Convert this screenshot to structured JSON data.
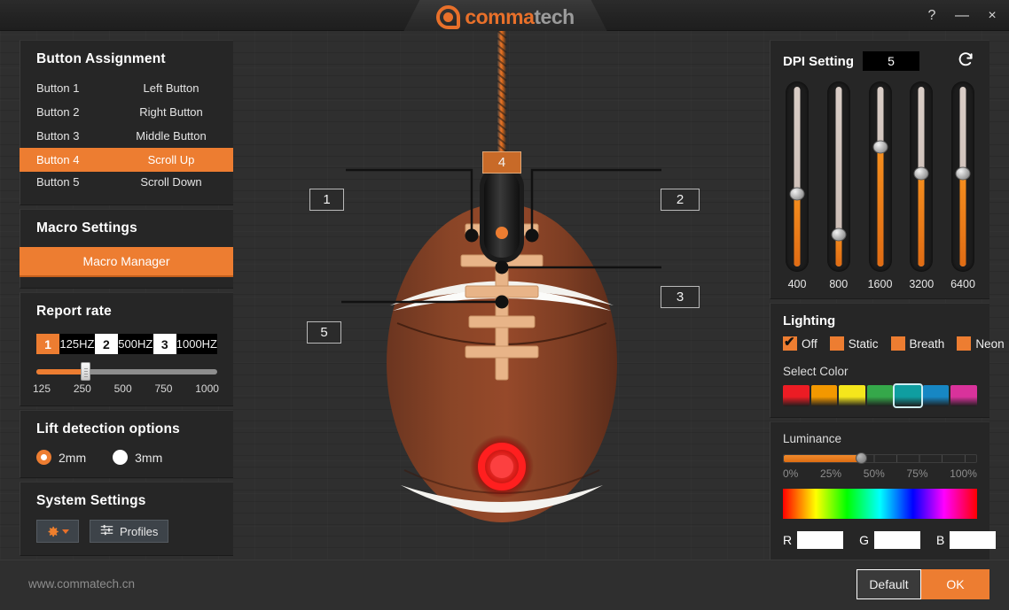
{
  "window": {
    "logo_primary": "comma",
    "logo_secondary": "tech",
    "help": "?",
    "minimize": "—",
    "close": "×"
  },
  "button_assignment": {
    "title": "Button Assignment",
    "rows": [
      {
        "key": "Button 1",
        "value": "Left Button",
        "active": false
      },
      {
        "key": "Button 2",
        "value": "Right Button",
        "active": false
      },
      {
        "key": "Button 3",
        "value": "Middle Button",
        "active": false
      },
      {
        "key": "Button 4",
        "value": "Scroll Up",
        "active": true
      },
      {
        "key": "Button 5",
        "value": "Scroll Down",
        "active": false
      }
    ]
  },
  "macro": {
    "title": "Macro Settings",
    "manager_label": "Macro Manager"
  },
  "report_rate": {
    "title": "Report rate",
    "options": [
      {
        "num": "1",
        "label": "125HZ",
        "selected": true
      },
      {
        "num": "2",
        "label": "500HZ",
        "selected": false
      },
      {
        "num": "3",
        "label": "1000HZ",
        "selected": false
      }
    ],
    "slider_value": 250,
    "slider_percent": 27,
    "ticks": [
      "125",
      "250",
      "500",
      "750",
      "1000"
    ]
  },
  "lift_detection": {
    "title": "Lift detection options",
    "options": [
      {
        "label": "2mm",
        "selected": true
      },
      {
        "label": "3mm",
        "selected": false
      }
    ]
  },
  "system_settings": {
    "title": "System Settings",
    "gear_label": "gear",
    "profiles_label": "Profiles"
  },
  "mouse_diagram": {
    "callouts": [
      {
        "id": "1",
        "highlight": false
      },
      {
        "id": "2",
        "highlight": false
      },
      {
        "id": "3",
        "highlight": false
      },
      {
        "id": "4",
        "highlight": true
      },
      {
        "id": "5",
        "highlight": false
      }
    ]
  },
  "dpi": {
    "title": "DPI Setting",
    "value": "5",
    "refresh_label": "refresh",
    "sliders": [
      {
        "label": "400",
        "percent": 44
      },
      {
        "label": "800",
        "percent": 21
      },
      {
        "label": "1600",
        "percent": 70
      },
      {
        "label": "3200",
        "percent": 55
      },
      {
        "label": "6400",
        "percent": 55
      }
    ]
  },
  "lighting": {
    "title": "Lighting",
    "modes": [
      {
        "label": "Off",
        "checked": true
      },
      {
        "label": "Static",
        "checked": false
      },
      {
        "label": "Breath",
        "checked": false
      },
      {
        "label": "Neon",
        "checked": false
      }
    ],
    "select_color_label": "Select Color",
    "swatches": [
      {
        "color": "#ec1c24",
        "selected": false
      },
      {
        "color": "#f39800",
        "selected": false
      },
      {
        "color": "#f5e61c",
        "selected": false
      },
      {
        "color": "#35a84a",
        "selected": false
      },
      {
        "color": "#0f9ea0",
        "selected": true
      },
      {
        "color": "#1787c4",
        "selected": false
      },
      {
        "color": "#d9329b",
        "selected": false
      }
    ],
    "luminance_label": "Luminance",
    "luminance_percent": 40,
    "luminance_ticks": [
      "0%",
      "25%",
      "50%",
      "75%",
      "100%"
    ],
    "rgb": [
      {
        "label": "R",
        "value": ""
      },
      {
        "label": "G",
        "value": ""
      },
      {
        "label": "B",
        "value": ""
      }
    ]
  },
  "footer": {
    "site": "www.commatech.cn",
    "default_label": "Default",
    "ok_label": "OK"
  },
  "colors": {
    "accent": "#ed7d31",
    "panel": "#262626",
    "canvas": "#2f2f2f"
  }
}
